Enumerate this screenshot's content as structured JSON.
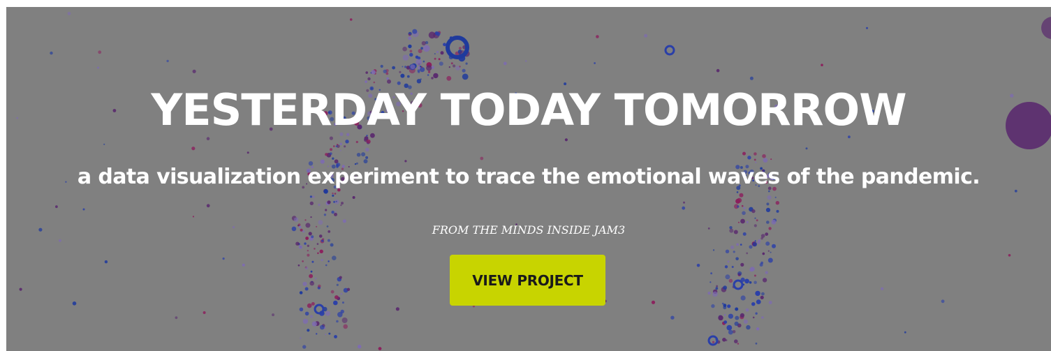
{
  "hero": {
    "title": "YESTERDAY TODAY TOMORROW",
    "subtitle": "a data visualization experiment to trace the emotional waves of the pandemic.",
    "credit": "FROM THE MINDS INSIDE JAM3",
    "cta_label": "VIEW PROJECT"
  },
  "colors": {
    "overlay": "#808080",
    "cta_background": "#c8d400",
    "title_text": "#ffffff",
    "cta_text": "#1a1a1a",
    "particle_colors": [
      "#2a3fa8",
      "#8b1f5c",
      "#5a2a6e",
      "#1f3a9c",
      "#7d6bb0"
    ]
  }
}
